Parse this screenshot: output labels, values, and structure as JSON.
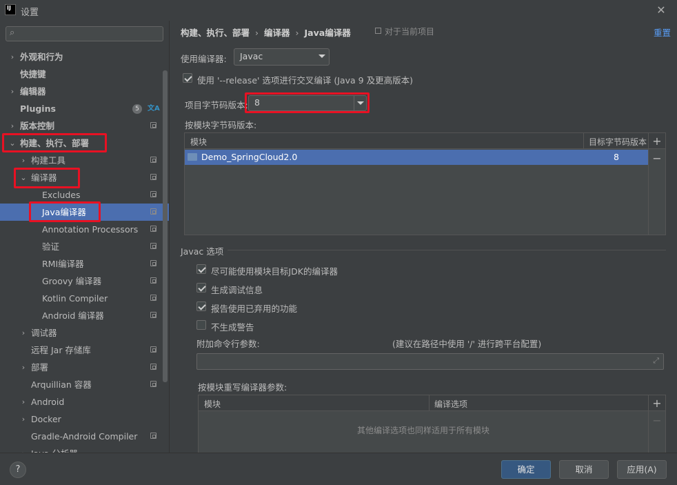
{
  "window": {
    "title": "设置",
    "icon": "intellij-icon",
    "icon_text": "IJ"
  },
  "search": {
    "placeholder": "",
    "value": ""
  },
  "sidebar": {
    "items": [
      {
        "label": "外观和行为",
        "arrow": "›",
        "bold": true
      },
      {
        "label": "快捷键",
        "bold": true
      },
      {
        "label": "编辑器",
        "arrow": "›",
        "bold": true
      },
      {
        "label": "Plugins",
        "bold": true,
        "badge": "5"
      },
      {
        "label": "版本控制",
        "arrow": "›",
        "bold": true
      },
      {
        "label": "构建、执行、部署",
        "arrow": "⌄",
        "bold": true
      },
      {
        "label": "构建工具",
        "arrow": "›"
      },
      {
        "label": "编译器",
        "arrow": "⌄"
      },
      {
        "label": "Excludes"
      },
      {
        "label": "Java编译器",
        "selected": true
      },
      {
        "label": "Annotation Processors"
      },
      {
        "label": "验证"
      },
      {
        "label": "RMI编译器"
      },
      {
        "label": "Groovy 编译器"
      },
      {
        "label": "Kotlin Compiler"
      },
      {
        "label": "Android 编译器"
      },
      {
        "label": "调试器",
        "arrow": "›"
      },
      {
        "label": "远程 Jar 存储库"
      },
      {
        "label": "部署",
        "arrow": "›"
      },
      {
        "label": "Arquillian 容器"
      },
      {
        "label": "Android",
        "arrow": "›"
      },
      {
        "label": "Docker",
        "arrow": "›"
      },
      {
        "label": "Gradle-Android Compiler"
      },
      {
        "label": "Java 分析器",
        "arrow": "›"
      }
    ]
  },
  "header": {
    "breadcrumb": [
      "构建、执行、部署",
      "编译器",
      "Java编译器"
    ],
    "scope": "对于当前项目",
    "reset": "重置"
  },
  "compiler": {
    "use_label": "使用编译器:",
    "use_value": "Javac",
    "release_label": "使用 '--release' 选项进行交叉编译 (Java 9 及更高版本)",
    "release_checked": true,
    "bytecode_label": "项目字节码版本:",
    "bytecode_value": "8",
    "per_module_label": "按模块字节码版本:"
  },
  "module_table": {
    "columns": [
      "模块",
      "目标字节码版本"
    ],
    "rows": [
      {
        "module": "Demo_SpringCloud2.0",
        "target": "8"
      }
    ],
    "add": "+",
    "remove": "−"
  },
  "javac": {
    "section_title": "Javac 选项",
    "options": [
      {
        "label": "尽可能使用模块目标JDK的编译器",
        "checked": true
      },
      {
        "label": "生成调试信息",
        "checked": true
      },
      {
        "label": "报告使用已弃用的功能",
        "checked": true
      },
      {
        "label": "不生成警告",
        "checked": false
      }
    ],
    "cmd_label": "附加命令行参数:",
    "cmd_hint": "(建议在路径中使用 '/' 进行跨平台配置)",
    "cmd_value": "",
    "override_label": "按模块重写编译器参数:"
  },
  "override_table": {
    "columns": [
      "模块",
      "编译选项"
    ],
    "empty_text": "其他编译选项也同样适用于所有模块",
    "add": "+",
    "remove": "−"
  },
  "footer": {
    "help": "?",
    "ok": "确定",
    "cancel": "取消",
    "apply": "应用(A)"
  }
}
